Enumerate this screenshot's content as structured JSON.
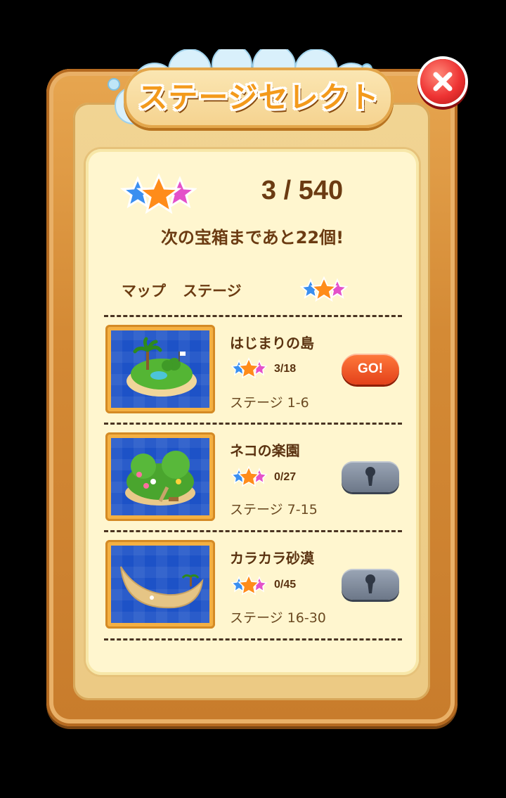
{
  "title": "ステージセレクト",
  "summary": {
    "stars_collected": "3 / 540",
    "next_chest_text": "次の宝箱まであと22個!"
  },
  "columns": {
    "map": "マップ",
    "stage": "ステージ"
  },
  "areas": [
    {
      "name": "はじまりの島",
      "stars": "3/18",
      "range": "ステージ 1-6",
      "action": "GO!",
      "locked": false
    },
    {
      "name": "ネコの楽園",
      "stars": "0/27",
      "range": "ステージ 7-15",
      "locked": true
    },
    {
      "name": "カラカラ砂漠",
      "stars": "0/45",
      "range": "ステージ 16-30",
      "locked": true
    }
  ],
  "colors": {
    "go_button": "#e3411a",
    "lock_button": "#6c7788",
    "sea": "#1d52c7",
    "close_button": "#e33333"
  },
  "icons": [
    "close-icon",
    "star-trio-icon",
    "lock-icon"
  ]
}
